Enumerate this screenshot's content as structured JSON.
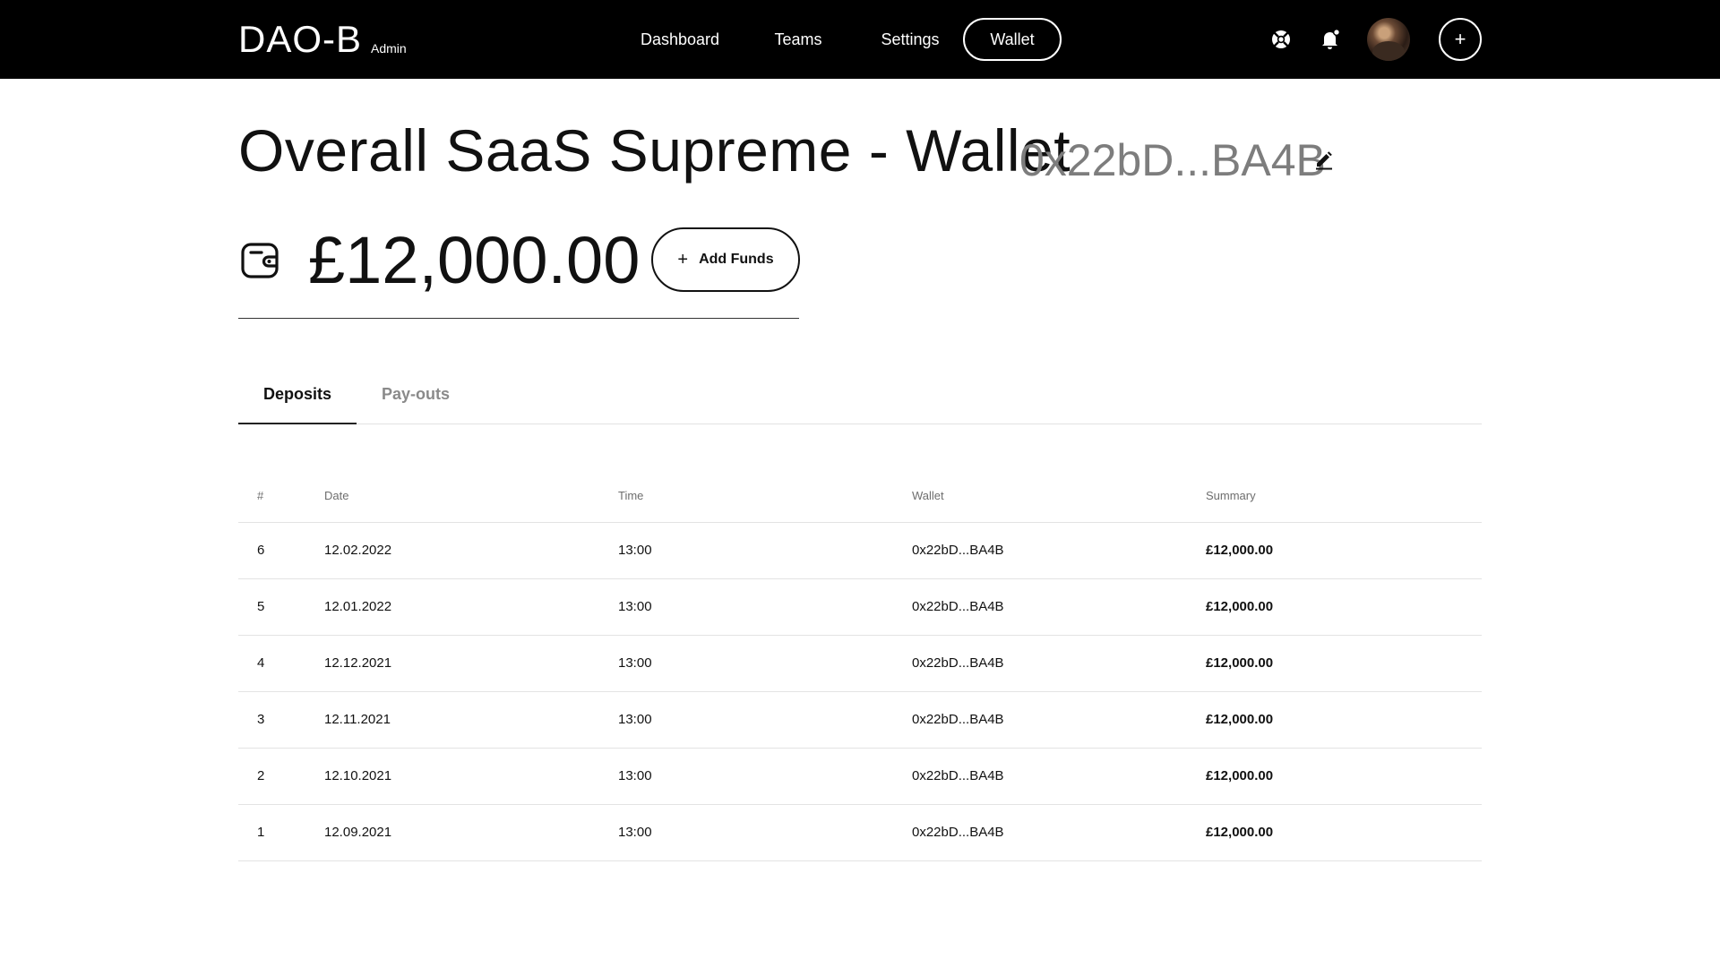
{
  "header": {
    "logo_text": "DAO-B",
    "logo_sub": "Admin",
    "nav": [
      {
        "label": "Dashboard",
        "active": false
      },
      {
        "label": "Teams",
        "active": false
      },
      {
        "label": "Settings",
        "active": false
      },
      {
        "label": "Wallet",
        "active": true
      }
    ],
    "icons": [
      "support-lifebuoy-icon",
      "notification-bell-icon",
      "user-avatar",
      "plus-icon"
    ],
    "plus_label": "+"
  },
  "page": {
    "title": "Overall SaaS Supreme - Wallet",
    "wallet_address": "0x22bD...BA4B",
    "balance": "£12,000.00",
    "add_funds_label": "Add Funds",
    "add_funds_icon": "+"
  },
  "tabs": [
    {
      "label": "Deposits",
      "active": true
    },
    {
      "label": "Pay-outs",
      "active": false
    }
  ],
  "table": {
    "columns": [
      "#",
      "Date",
      "Time",
      "Wallet",
      "Summary"
    ],
    "rows": [
      {
        "num": "6",
        "date": "12.02.2022",
        "time": "13:00",
        "wallet": "0x22bD...BA4B",
        "summary": "£12,000.00"
      },
      {
        "num": "5",
        "date": "12.01.2022",
        "time": "13:00",
        "wallet": "0x22bD...BA4B",
        "summary": "£12,000.00"
      },
      {
        "num": "4",
        "date": "12.12.2021",
        "time": "13:00",
        "wallet": "0x22bD...BA4B",
        "summary": "£12,000.00"
      },
      {
        "num": "3",
        "date": "12.11.2021",
        "time": "13:00",
        "wallet": "0x22bD...BA4B",
        "summary": "£12,000.00"
      },
      {
        "num": "2",
        "date": "12.10.2021",
        "time": "13:00",
        "wallet": "0x22bD...BA4B",
        "summary": "£12,000.00"
      },
      {
        "num": "1",
        "date": "12.09.2021",
        "time": "13:00",
        "wallet": "0x22bD...BA4B",
        "summary": "£12,000.00"
      }
    ]
  },
  "colors": {
    "header_bg": "#000000",
    "text": "#111111",
    "muted": "#7d7d7d",
    "divider": "#e3e3e3"
  }
}
